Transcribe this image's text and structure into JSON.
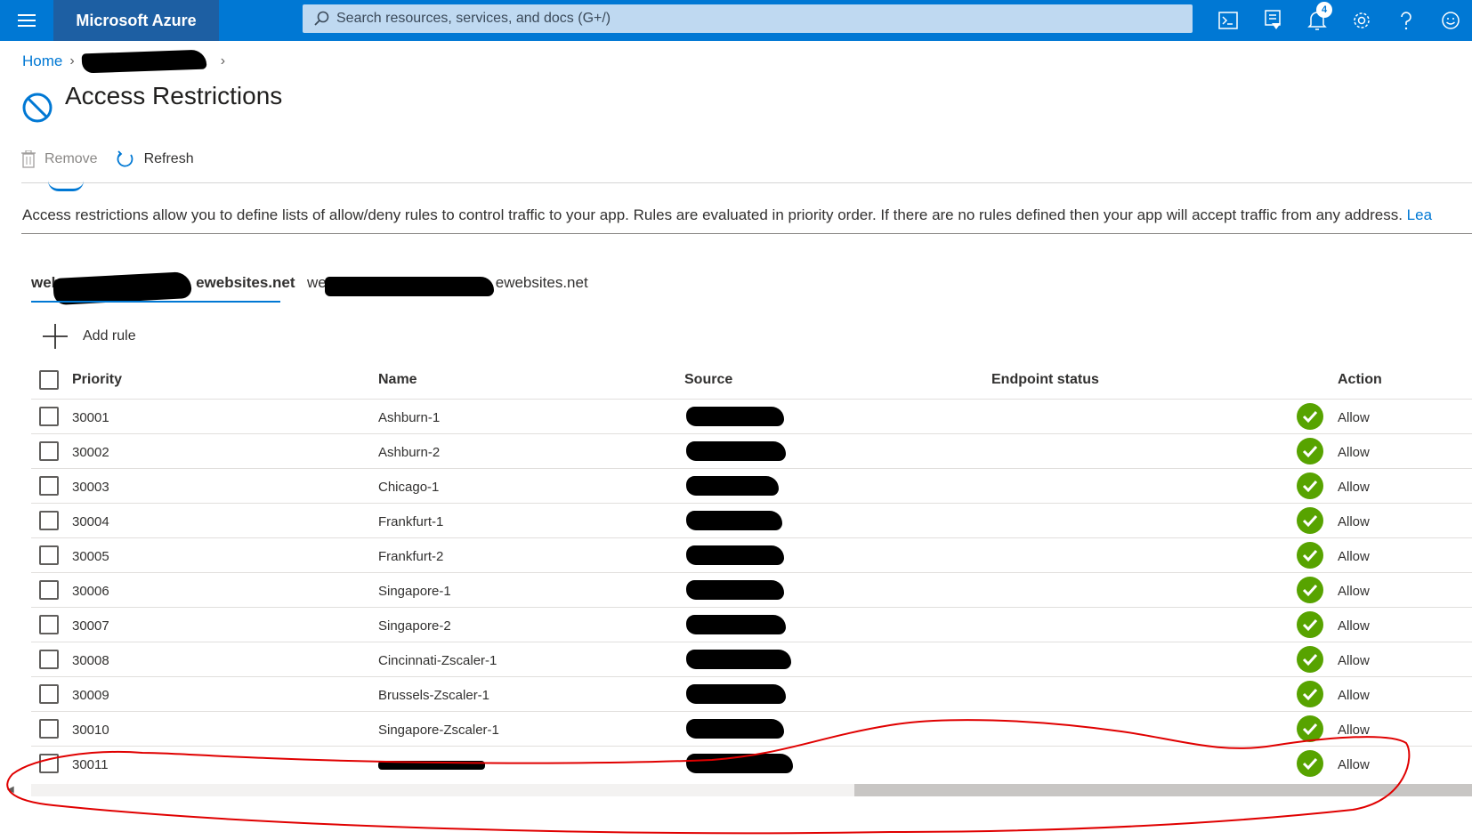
{
  "topbar": {
    "brand": "Microsoft Azure",
    "search_placeholder": "Search resources, services, and docs (G+/)",
    "notifications_count": "4",
    "icons": [
      "hamburger-icon",
      "search-icon",
      "cloud-shell-icon",
      "directory-filter-icon",
      "notifications-icon",
      "settings-icon",
      "help-icon",
      "feedback-icon"
    ]
  },
  "breadcrumb": {
    "home": "Home"
  },
  "page": {
    "title": "Access Restrictions"
  },
  "toolbar": {
    "remove": "Remove",
    "refresh": "Refresh"
  },
  "description": {
    "text": "Access restrictions allow you to define lists of allow/deny rules to control traffic to your app. Rules are evaluated in priority order. If there are no rules defined then your app will accept traffic from any address. ",
    "link": "Lea"
  },
  "site_tabs": [
    {
      "prefix": "web",
      "suffix": "ewebsites.net"
    },
    {
      "prefix": "we",
      "suffix": "ewebsites.net"
    }
  ],
  "add_rule": "Add rule",
  "table": {
    "columns": {
      "priority": "Priority",
      "name": "Name",
      "source": "Source",
      "endpoint_status": "Endpoint status",
      "action": "Action"
    },
    "rows": [
      {
        "priority": "30001",
        "name": "Ashburn-1",
        "action": "Allow"
      },
      {
        "priority": "30002",
        "name": "Ashburn-2",
        "action": "Allow"
      },
      {
        "priority": "30003",
        "name": "Chicago-1",
        "action": "Allow"
      },
      {
        "priority": "30004",
        "name": "Frankfurt-1",
        "action": "Allow"
      },
      {
        "priority": "30005",
        "name": "Frankfurt-2",
        "action": "Allow"
      },
      {
        "priority": "30006",
        "name": "Singapore-1",
        "action": "Allow"
      },
      {
        "priority": "30007",
        "name": "Singapore-2",
        "action": "Allow"
      },
      {
        "priority": "30008",
        "name": "Cincinnati-Zscaler-1",
        "action": "Allow"
      },
      {
        "priority": "30009",
        "name": "Brussels-Zscaler-1",
        "action": "Allow"
      },
      {
        "priority": "30010",
        "name": "Singapore-Zscaler-1",
        "action": "Allow"
      },
      {
        "priority": "30011",
        "name": "",
        "action": "Allow"
      }
    ]
  },
  "colors": {
    "azure_blue": "#0078d4",
    "allow_green": "#57a300",
    "annotation_red": "#e00000"
  }
}
